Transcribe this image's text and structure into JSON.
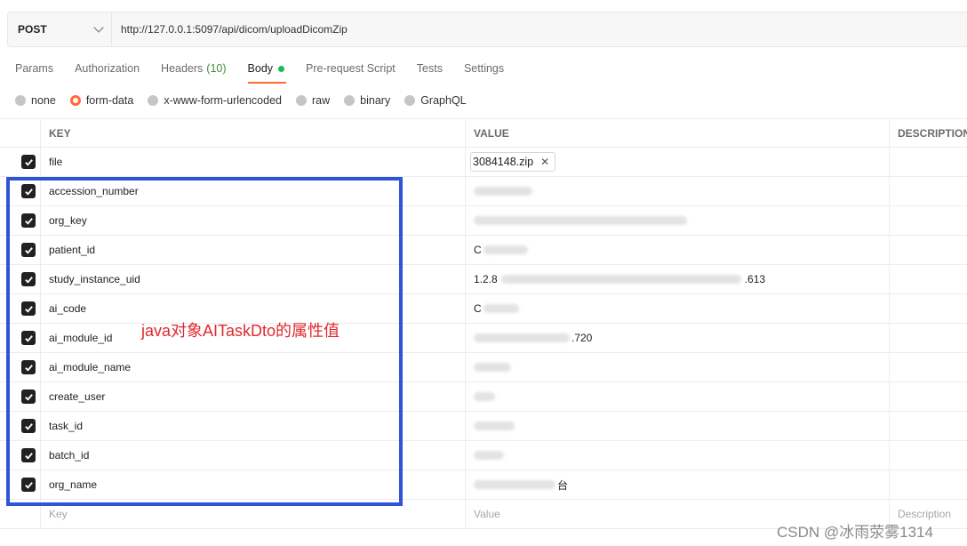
{
  "request": {
    "method": "POST",
    "url": "http://127.0.0.1:5097/api/dicom/uploadDicomZip"
  },
  "tabs": [
    {
      "label": "Params"
    },
    {
      "label": "Authorization"
    },
    {
      "label": "Headers",
      "count": "(10)"
    },
    {
      "label": "Body",
      "active": true
    },
    {
      "label": "Pre-request Script"
    },
    {
      "label": "Tests"
    },
    {
      "label": "Settings"
    }
  ],
  "body_types": [
    {
      "label": "none"
    },
    {
      "label": "form-data",
      "selected": true
    },
    {
      "label": "x-www-form-urlencoded"
    },
    {
      "label": "raw"
    },
    {
      "label": "binary"
    },
    {
      "label": "GraphQL"
    }
  ],
  "table": {
    "headers": {
      "key": "KEY",
      "value": "VALUE",
      "description": "DESCRIPTION"
    },
    "rows": [
      {
        "key": "file",
        "value": "3084148.zip",
        "type": "file"
      },
      {
        "key": "accession_number",
        "value": ""
      },
      {
        "key": "org_key",
        "value": ""
      },
      {
        "key": "patient_id",
        "value": "C"
      },
      {
        "key": "study_instance_uid",
        "value": "1.2.8",
        "value_suffix": ".613"
      },
      {
        "key": "ai_code",
        "value": "C"
      },
      {
        "key": "ai_module_id",
        "value": "",
        "value_suffix": ".720"
      },
      {
        "key": "ai_module_name",
        "value": ""
      },
      {
        "key": "create_user",
        "value": ""
      },
      {
        "key": "task_id",
        "value": ""
      },
      {
        "key": "batch_id",
        "value": ""
      },
      {
        "key": "org_name",
        "value": "",
        "value_suffix": "台"
      }
    ],
    "placeholder": {
      "key": "Key",
      "value": "Value",
      "description": "Description"
    }
  },
  "annotation": "java对象AITaskDto的属性值",
  "watermark": "CSDN @冰雨荥雾1314",
  "colors": {
    "accent": "#ff6c37",
    "highlight_box": "#2f54d6",
    "annotation": "#e0282e",
    "checkbox": "#212121"
  }
}
